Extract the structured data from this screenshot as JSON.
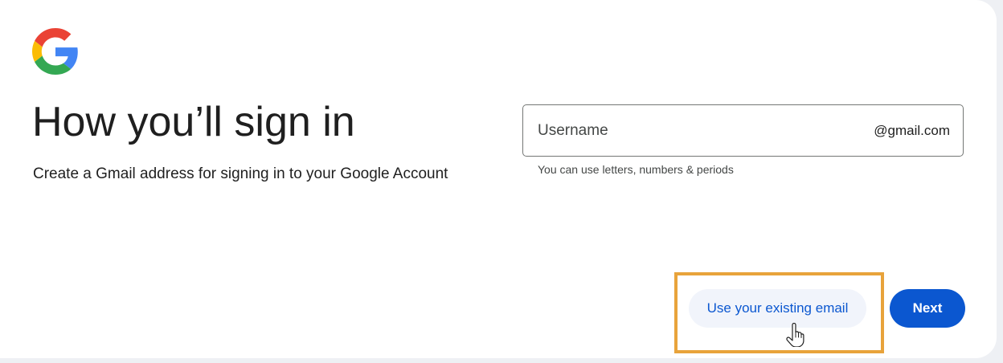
{
  "brand": {
    "logo_icon": "google-g-logo",
    "colors": {
      "blue": "#4285F4",
      "red": "#EA4335",
      "yellow": "#FBBC05",
      "green": "#34A853"
    }
  },
  "header": {
    "title": "How you’ll sign in",
    "subtitle": "Create a Gmail address for signing in to your Google Account"
  },
  "username_field": {
    "placeholder": "Username",
    "value": "",
    "suffix": "@gmail.com",
    "helper": "You can use letters, numbers & periods"
  },
  "actions": {
    "existing_email_label": "Use your existing email",
    "next_label": "Next",
    "primary_color": "#0b57d0",
    "highlight_color": "#e8a33b"
  },
  "cursor_icon": "hand-pointer-icon"
}
